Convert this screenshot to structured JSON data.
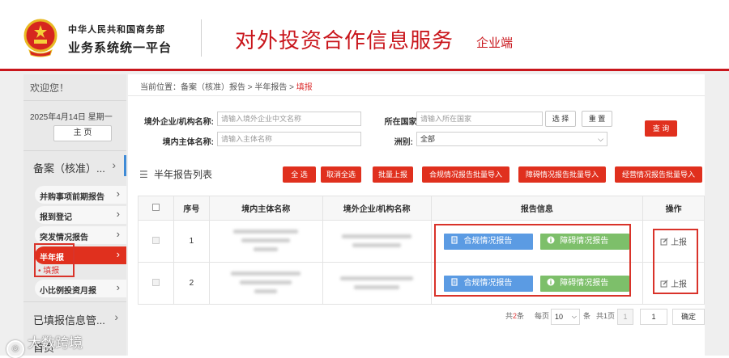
{
  "header": {
    "org": "中华人民共和国商务部",
    "system": "业务系统统一平台",
    "title": "对外投资合作信息服务",
    "subtitle": "企业端"
  },
  "sidebar": {
    "welcome": "欢迎您！",
    "date": "2025年4月14日 星期一",
    "home_label": "主 页",
    "section1": "备案（核准）...",
    "items": [
      {
        "label": "并购事项前期报告"
      },
      {
        "label": "报到登记"
      },
      {
        "label": "突发情况报告"
      },
      {
        "label": "半年报"
      },
      {
        "label": "小比例投资月报"
      }
    ],
    "leaf": "• 填报",
    "section2": "已填报信息管...",
    "section3": "首页"
  },
  "breadcrumb": {
    "prefix": "当前位置：",
    "path": "备案（核准）报告 > 半年报告 > ",
    "current": "填报"
  },
  "filters": {
    "overseas_label": "境外企业/机构名称:",
    "overseas_placeholder": "请输入境外企业中文名称",
    "country_label": "所在国家:",
    "country_placeholder": "请输入所在国家",
    "select_label": "选 择",
    "reset_label": "重 置",
    "domestic_label": "境内主体名称:",
    "domestic_placeholder": "请输入主体名称",
    "continent_label": "洲别:",
    "continent_value": "全部",
    "query_label": "查 询"
  },
  "list": {
    "title": "半年报告列表",
    "actions": [
      "全 选",
      "取消全选",
      "批量上报",
      "合规情况报告批量导入",
      "障碍情况报告批量导入",
      "经营情况报告批量导入"
    ]
  },
  "table": {
    "headers": [
      "",
      "序号",
      "境内主体名称",
      "境外企业/机构名称",
      "报告信息",
      "操作"
    ],
    "rows": [
      {
        "index": "1",
        "report1": "合规情况报告",
        "report2": "障碍情况报告",
        "op": "上报"
      },
      {
        "index": "2",
        "report1": "合规情况报告",
        "report2": "障碍情况报告",
        "op": "上报"
      }
    ]
  },
  "pager": {
    "total_prefix": "共",
    "total": "2",
    "total_suffix": "条",
    "per_page": "每页",
    "page_size": "10",
    "unit": "条",
    "pages": "共1页",
    "page_num": "1",
    "jump_value": "1",
    "confirm": "确定"
  },
  "watermark": "大数跨境",
  "colors": {
    "brand_red": "#c9161c",
    "button_red": "#e0301e",
    "blue_report": "#5b9be3",
    "green_report": "#7dbf6a",
    "nav_accent": "#3f8bd6"
  }
}
